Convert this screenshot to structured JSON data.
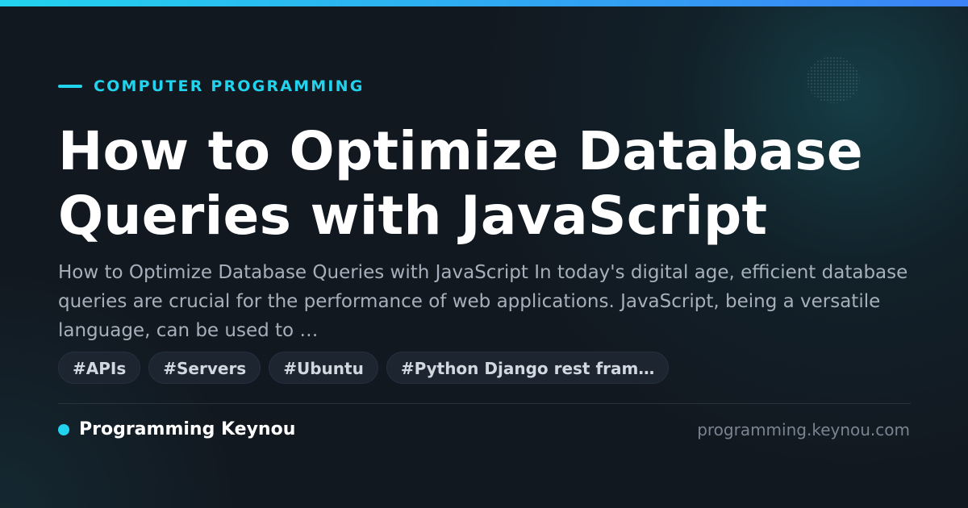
{
  "category": {
    "label": "COMPUTER PROGRAMMING"
  },
  "article": {
    "title": "How to Optimize Database Queries with JavaScript",
    "excerpt": "How to Optimize Database Queries with JavaScript In today's digital age, efficient database queries are crucial for the performance of web applications. JavaScript, being a versatile language, can be used to …"
  },
  "tags": [
    {
      "label": "#APIs"
    },
    {
      "label": "#Servers"
    },
    {
      "label": "#Ubuntu"
    },
    {
      "label": "#Python Django rest fram…"
    }
  ],
  "footer": {
    "brand": "Programming Keynou",
    "domain": "programming.keynou.com"
  },
  "colors": {
    "accent": "#22d3ee",
    "background": "#121820",
    "title": "#ffffff",
    "excerpt": "#a7afbb",
    "tag_background": "#1d2530",
    "domain": "#7a8390"
  }
}
